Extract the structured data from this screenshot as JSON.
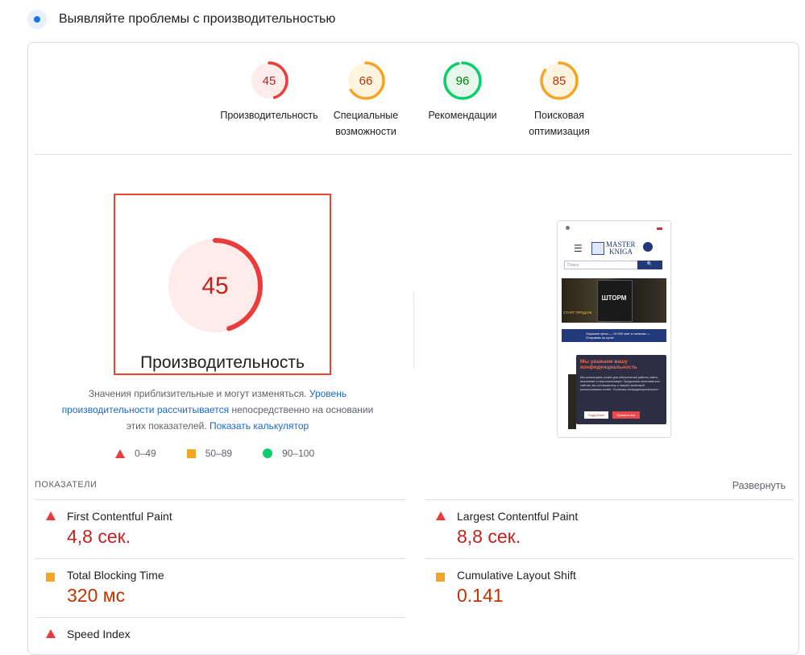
{
  "header": {
    "title": "Выявляйте проблемы с производительностью",
    "icon": "lighthouse-icon"
  },
  "categories": [
    {
      "score": "45",
      "label_line1": "Производительность",
      "label_line2": "",
      "status": "fail",
      "color": "#eb3b3b",
      "bg": "#fdecea",
      "text_color": "#c5221f",
      "fraction": 0.45
    },
    {
      "score": "66",
      "label_line1": "Специальные",
      "label_line2": "возможности",
      "status": "average",
      "color": "#f5a524",
      "bg": "#fff4e0",
      "text_color": "#c33300",
      "fraction": 0.66
    },
    {
      "score": "96",
      "label_line1": "Рекомендации",
      "label_line2": "",
      "status": "pass",
      "color": "#0cce6b",
      "bg": "#e6f7ed",
      "text_color": "#008000",
      "fraction": 0.96
    },
    {
      "score": "85",
      "label_line1": "Поисковая",
      "label_line2": "оптимизация",
      "status": "average",
      "color": "#f5a524",
      "bg": "#fff4e0",
      "text_color": "#c33300",
      "fraction": 0.85
    }
  ],
  "main_gauge": {
    "score": "45",
    "label": "Производительность",
    "fraction": 0.45
  },
  "note": {
    "text1": "Значения приблизительные и могут изменяться.",
    "link1": "Уровень производительности рассчитывается",
    "text2": "непосредственно на основании этих показателей.",
    "link2": "Показать калькулятор"
  },
  "legend": [
    {
      "range": "0–49",
      "icon": "red-triangle-icon"
    },
    {
      "range": "50–89",
      "icon": "orange-square-icon"
    },
    {
      "range": "90–100",
      "icon": "green-circle-icon"
    }
  ],
  "screenshot": {
    "logo_line1": "MASTER",
    "logo_line2": "KNIGA",
    "search_placeholder": "Поиск",
    "banner_title": "ШТОРМ",
    "banner_left": "СТАРТ ПРОДАЖ",
    "strip_text": "Хорошие цены — 10 000 книг в наличии — Отправим за сутки",
    "popup_title": "Мы уважаем вашу конфиденциальность",
    "popup_text": "Мы используем cookie для обеспечения работы сайта, аналитики и персонализации. Продолжая пользоваться сайтом, вы соглашаетесь с нашей политикой использования cookie. Политика конфиденциальности",
    "btn_more": "Подробнее",
    "btn_accept": "Принять все"
  },
  "metrics_section": {
    "title": "ПОКАЗАТЕЛИ",
    "expand": "Развернуть"
  },
  "metrics": [
    {
      "name": "First Contentful Paint",
      "value": "4,8 сек.",
      "status": "fail"
    },
    {
      "name": "Largest Contentful Paint",
      "value": "8,8 сек.",
      "status": "fail"
    },
    {
      "name": "Total Blocking Time",
      "value": "320 мс",
      "status": "average"
    },
    {
      "name": "Cumulative Layout Shift",
      "value": "0.141",
      "status": "average"
    },
    {
      "name": "Speed Index",
      "value": "",
      "status": "fail"
    }
  ]
}
